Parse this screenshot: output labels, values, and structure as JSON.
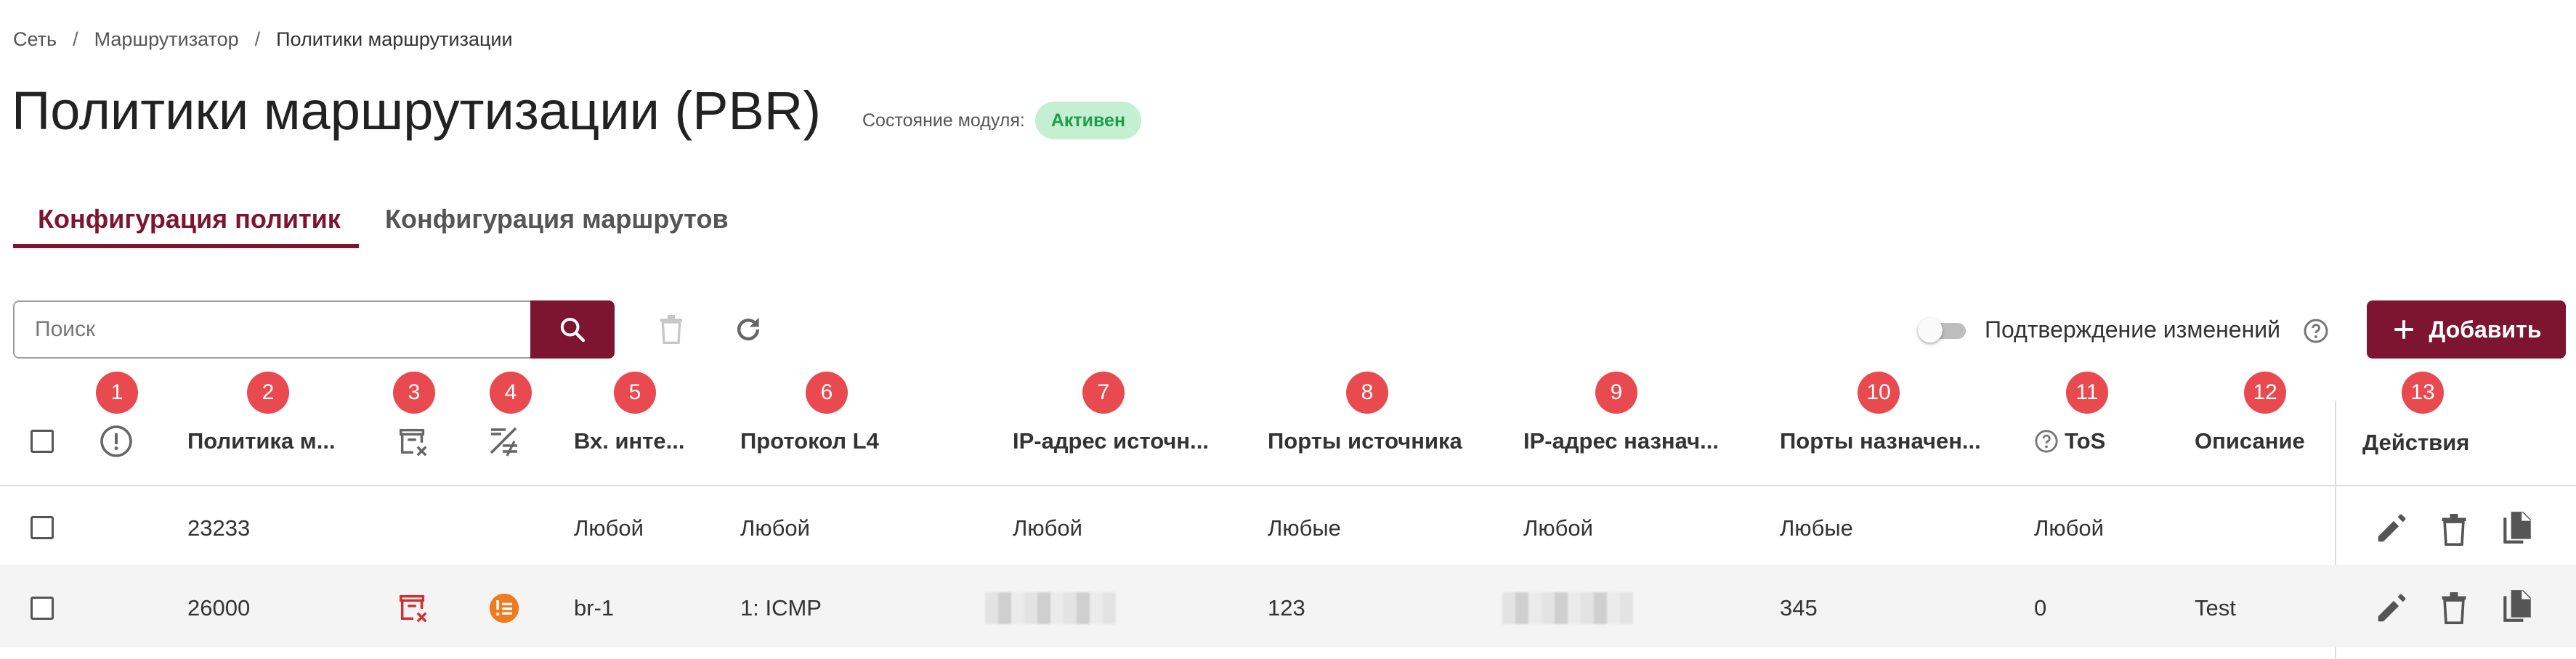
{
  "breadcrumb": {
    "items": [
      "Сеть",
      "Маршрутизатор",
      "Политики маршрутизации"
    ],
    "separator": "/"
  },
  "page": {
    "title": "Политики маршрутизации (PBR)",
    "module_state_label": "Состояние модуля:",
    "module_state_value": "Активен"
  },
  "tabs": [
    {
      "label": "Конфигурация политик",
      "active": true
    },
    {
      "label": "Конфигурация маршрутов",
      "active": false
    }
  ],
  "toolbar": {
    "search_placeholder": "Поиск",
    "confirm_changes_label": "Подтверждение изменений",
    "add_label": "Добавить"
  },
  "markers": [
    "1",
    "2",
    "3",
    "4",
    "5",
    "6",
    "7",
    "8",
    "9",
    "10",
    "11",
    "12",
    "13"
  ],
  "table": {
    "headers": {
      "policy": "Политика м...",
      "in_iface": "Вх. инте...",
      "protocol": "Протокол L4",
      "src_ip": "IP-адрес источн...",
      "src_ports": "Порты источника",
      "dst_ip": "IP-адрес назнач...",
      "dst_ports": "Порты назначен...",
      "tos": "ToS",
      "description": "Описание",
      "actions": "Действия"
    },
    "rows": [
      {
        "policy": "23233",
        "in_iface": "Любой",
        "protocol": "Любой",
        "src_ip": "Любой",
        "src_ports": "Любые",
        "dst_ip": "Любой",
        "dst_ports": "Любые",
        "tos": "Любой",
        "description": ""
      },
      {
        "policy": "26000",
        "in_iface": "br-1",
        "protocol": "1: ICMP",
        "src_ports": "123",
        "dst_ports": "345",
        "tos": "0",
        "description": "Test"
      }
    ]
  },
  "colors": {
    "accent": "#7e1530",
    "badge_red": "#e84a4f",
    "status_green_bg": "#c4efd1",
    "status_green_text": "#1e9e4b",
    "warning_orange": "#f07a1e",
    "error_red": "#d32f2f"
  }
}
